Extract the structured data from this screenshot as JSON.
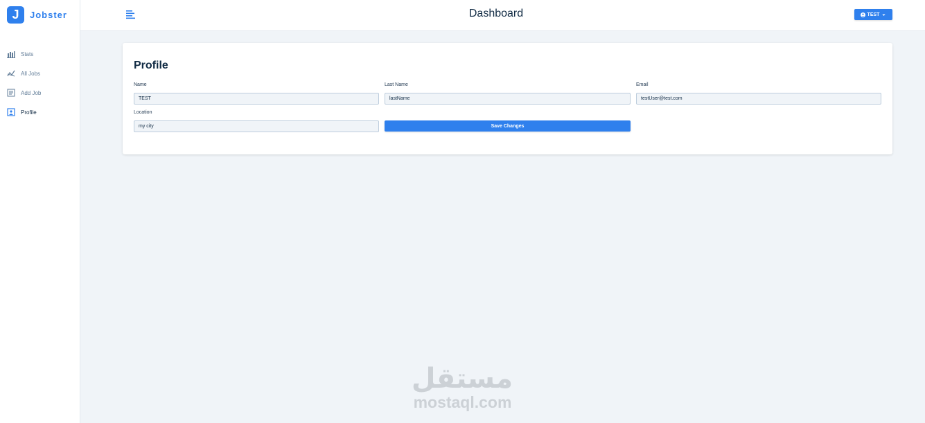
{
  "app": {
    "logo_letter": "J",
    "logo_name": "Jobster"
  },
  "sidebar": {
    "items": [
      {
        "label": "Stats",
        "icon": "bar-chart-icon",
        "active": false
      },
      {
        "label": "All Jobs",
        "icon": "query-stats-icon",
        "active": false
      },
      {
        "label": "Add Job",
        "icon": "form-icon",
        "active": false
      },
      {
        "label": "Profile",
        "icon": "profile-icon",
        "active": true
      }
    ]
  },
  "header": {
    "title": "Dashboard",
    "user_label": "TEST"
  },
  "profile": {
    "title": "Profile",
    "name_label": "Name",
    "name_value": "TEST",
    "last_name_label": "Last Name",
    "last_name_value": "lastName",
    "email_label": "Email",
    "email_value": "testUser@test.com",
    "location_label": "Location",
    "location_value": "my city",
    "save_label": "Save Changes"
  },
  "watermark": {
    "latin": "mostaql.com",
    "arabic": "مستقل"
  },
  "colors": {
    "primary": "#2f80ed",
    "background": "#f0f4f8",
    "card": "#ffffff",
    "text": "#102a43"
  }
}
